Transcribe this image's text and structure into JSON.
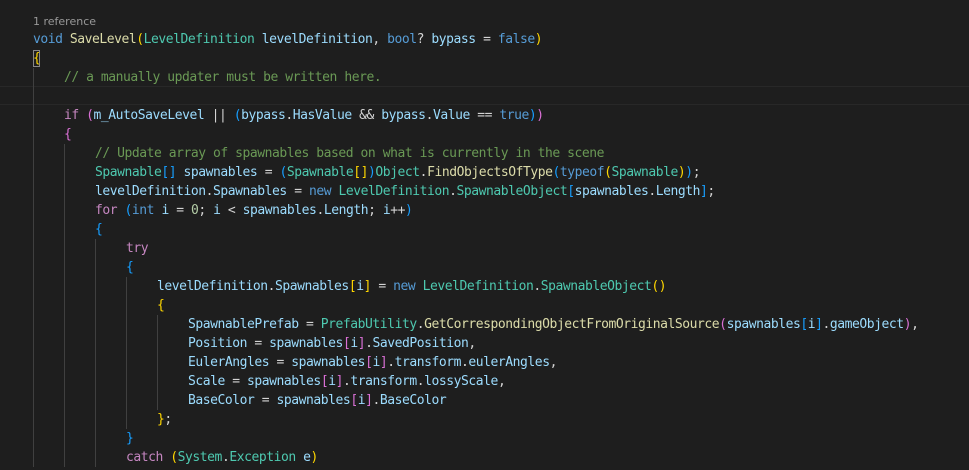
{
  "codelens": {
    "references": "1 reference"
  },
  "theme": {
    "background": "#1e1e1e",
    "keyword": "#569cd6",
    "control": "#c586c0",
    "type": "#4ec9b0",
    "method": "#dcdcaa",
    "variable": "#9cdcfe",
    "comment": "#6a9955",
    "number": "#b5cea8",
    "brace_gold": "#ffd700",
    "brace_purple": "#da70d6",
    "brace_blue": "#179fff",
    "plain": "#d4d4d4"
  },
  "code": [
    {
      "indent": 0,
      "tokens": [
        {
          "t": "void ",
          "c": "keyword"
        },
        {
          "t": "SaveLevel",
          "c": "method"
        },
        {
          "t": "(",
          "c": "brace_gold"
        },
        {
          "t": "LevelDefinition",
          "c": "type"
        },
        {
          "t": " ",
          "c": "plain"
        },
        {
          "t": "levelDefinition",
          "c": "variable"
        },
        {
          "t": ", ",
          "c": "plain"
        },
        {
          "t": "bool",
          "c": "keyword"
        },
        {
          "t": "? ",
          "c": "plain"
        },
        {
          "t": "bypass",
          "c": "variable"
        },
        {
          "t": " = ",
          "c": "plain"
        },
        {
          "t": "false",
          "c": "keyword"
        },
        {
          "t": ")",
          "c": "brace_gold"
        }
      ]
    },
    {
      "indent": 0,
      "tokens": [
        {
          "t": "{",
          "c": "brace_gold"
        }
      ]
    },
    {
      "indent": 1,
      "tokens": [
        {
          "t": "// a manually updater must be written here.",
          "c": "comment"
        }
      ]
    },
    {
      "indent": 0,
      "tokens": []
    },
    {
      "indent": 1,
      "tokens": [
        {
          "t": "if",
          "c": "control"
        },
        {
          "t": " ",
          "c": "plain"
        },
        {
          "t": "(",
          "c": "brace_purple"
        },
        {
          "t": "m_AutoSaveLevel",
          "c": "variable"
        },
        {
          "t": " || ",
          "c": "plain"
        },
        {
          "t": "(",
          "c": "brace_blue"
        },
        {
          "t": "bypass",
          "c": "variable"
        },
        {
          "t": ".",
          "c": "plain"
        },
        {
          "t": "HasValue",
          "c": "variable"
        },
        {
          "t": " && ",
          "c": "plain"
        },
        {
          "t": "bypass",
          "c": "variable"
        },
        {
          "t": ".",
          "c": "plain"
        },
        {
          "t": "Value",
          "c": "variable"
        },
        {
          "t": " == ",
          "c": "plain"
        },
        {
          "t": "true",
          "c": "keyword"
        },
        {
          "t": ")",
          "c": "brace_blue"
        },
        {
          "t": ")",
          "c": "brace_purple"
        }
      ]
    },
    {
      "indent": 1,
      "tokens": [
        {
          "t": "{",
          "c": "brace_purple"
        }
      ]
    },
    {
      "indent": 2,
      "tokens": [
        {
          "t": "// Update array of spawnables based on what is currently in the scene",
          "c": "comment"
        }
      ]
    },
    {
      "indent": 2,
      "tokens": [
        {
          "t": "Spawnable",
          "c": "type"
        },
        {
          "t": "[]",
          "c": "brace_blue"
        },
        {
          "t": " ",
          "c": "plain"
        },
        {
          "t": "spawnables",
          "c": "variable"
        },
        {
          "t": " = ",
          "c": "plain"
        },
        {
          "t": "(",
          "c": "brace_blue"
        },
        {
          "t": "Spawnable",
          "c": "type"
        },
        {
          "t": "[]",
          "c": "brace_gold"
        },
        {
          "t": ")",
          "c": "brace_blue"
        },
        {
          "t": "Object",
          "c": "type"
        },
        {
          "t": ".",
          "c": "plain"
        },
        {
          "t": "FindObjectsOfType",
          "c": "method"
        },
        {
          "t": "(",
          "c": "brace_blue"
        },
        {
          "t": "typeof",
          "c": "keyword"
        },
        {
          "t": "(",
          "c": "brace_gold"
        },
        {
          "t": "Spawnable",
          "c": "type"
        },
        {
          "t": ")",
          "c": "brace_gold"
        },
        {
          "t": ")",
          "c": "brace_blue"
        },
        {
          "t": ";",
          "c": "plain"
        }
      ]
    },
    {
      "indent": 2,
      "tokens": [
        {
          "t": "levelDefinition",
          "c": "variable"
        },
        {
          "t": ".",
          "c": "plain"
        },
        {
          "t": "Spawnables",
          "c": "variable"
        },
        {
          "t": " = ",
          "c": "plain"
        },
        {
          "t": "new",
          "c": "keyword"
        },
        {
          "t": " ",
          "c": "plain"
        },
        {
          "t": "LevelDefinition",
          "c": "type"
        },
        {
          "t": ".",
          "c": "plain"
        },
        {
          "t": "SpawnableObject",
          "c": "type"
        },
        {
          "t": "[",
          "c": "brace_blue"
        },
        {
          "t": "spawnables",
          "c": "variable"
        },
        {
          "t": ".",
          "c": "plain"
        },
        {
          "t": "Length",
          "c": "variable"
        },
        {
          "t": "]",
          "c": "brace_blue"
        },
        {
          "t": ";",
          "c": "plain"
        }
      ]
    },
    {
      "indent": 2,
      "tokens": [
        {
          "t": "for",
          "c": "control"
        },
        {
          "t": " ",
          "c": "plain"
        },
        {
          "t": "(",
          "c": "brace_blue"
        },
        {
          "t": "int",
          "c": "keyword"
        },
        {
          "t": " ",
          "c": "plain"
        },
        {
          "t": "i",
          "c": "variable"
        },
        {
          "t": " = ",
          "c": "plain"
        },
        {
          "t": "0",
          "c": "number"
        },
        {
          "t": "; ",
          "c": "plain"
        },
        {
          "t": "i",
          "c": "variable"
        },
        {
          "t": " < ",
          "c": "plain"
        },
        {
          "t": "spawnables",
          "c": "variable"
        },
        {
          "t": ".",
          "c": "plain"
        },
        {
          "t": "Length",
          "c": "variable"
        },
        {
          "t": "; ",
          "c": "plain"
        },
        {
          "t": "i",
          "c": "variable"
        },
        {
          "t": "++",
          "c": "plain"
        },
        {
          "t": ")",
          "c": "brace_blue"
        }
      ]
    },
    {
      "indent": 2,
      "tokens": [
        {
          "t": "{",
          "c": "brace_blue"
        }
      ]
    },
    {
      "indent": 3,
      "tokens": [
        {
          "t": "try",
          "c": "control"
        }
      ]
    },
    {
      "indent": 3,
      "tokens": [
        {
          "t": "{",
          "c": "brace_blue"
        }
      ]
    },
    {
      "indent": 4,
      "tokens": [
        {
          "t": "levelDefinition",
          "c": "variable"
        },
        {
          "t": ".",
          "c": "plain"
        },
        {
          "t": "Spawnables",
          "c": "variable"
        },
        {
          "t": "[",
          "c": "brace_gold"
        },
        {
          "t": "i",
          "c": "variable"
        },
        {
          "t": "]",
          "c": "brace_gold"
        },
        {
          "t": " = ",
          "c": "plain"
        },
        {
          "t": "new",
          "c": "keyword"
        },
        {
          "t": " ",
          "c": "plain"
        },
        {
          "t": "LevelDefinition",
          "c": "type"
        },
        {
          "t": ".",
          "c": "plain"
        },
        {
          "t": "SpawnableObject",
          "c": "type"
        },
        {
          "t": "()",
          "c": "brace_gold"
        }
      ]
    },
    {
      "indent": 4,
      "tokens": [
        {
          "t": "{",
          "c": "brace_gold"
        }
      ]
    },
    {
      "indent": 5,
      "tokens": [
        {
          "t": "SpawnablePrefab",
          "c": "variable"
        },
        {
          "t": " = ",
          "c": "plain"
        },
        {
          "t": "PrefabUtility",
          "c": "type"
        },
        {
          "t": ".",
          "c": "plain"
        },
        {
          "t": "GetCorrespondingObjectFromOriginalSource",
          "c": "method"
        },
        {
          "t": "(",
          "c": "brace_purple"
        },
        {
          "t": "spawnables",
          "c": "variable"
        },
        {
          "t": "[",
          "c": "brace_blue"
        },
        {
          "t": "i",
          "c": "variable"
        },
        {
          "t": "]",
          "c": "brace_blue"
        },
        {
          "t": ".",
          "c": "plain"
        },
        {
          "t": "gameObject",
          "c": "variable"
        },
        {
          "t": ")",
          "c": "brace_purple"
        },
        {
          "t": ",",
          "c": "plain"
        }
      ]
    },
    {
      "indent": 5,
      "tokens": [
        {
          "t": "Position",
          "c": "variable"
        },
        {
          "t": " = ",
          "c": "plain"
        },
        {
          "t": "spawnables",
          "c": "variable"
        },
        {
          "t": "[",
          "c": "brace_purple"
        },
        {
          "t": "i",
          "c": "variable"
        },
        {
          "t": "]",
          "c": "brace_purple"
        },
        {
          "t": ".",
          "c": "plain"
        },
        {
          "t": "SavedPosition",
          "c": "variable"
        },
        {
          "t": ",",
          "c": "plain"
        }
      ]
    },
    {
      "indent": 5,
      "tokens": [
        {
          "t": "EulerAngles",
          "c": "variable"
        },
        {
          "t": " = ",
          "c": "plain"
        },
        {
          "t": "spawnables",
          "c": "variable"
        },
        {
          "t": "[",
          "c": "brace_purple"
        },
        {
          "t": "i",
          "c": "variable"
        },
        {
          "t": "]",
          "c": "brace_purple"
        },
        {
          "t": ".",
          "c": "plain"
        },
        {
          "t": "transform",
          "c": "variable"
        },
        {
          "t": ".",
          "c": "plain"
        },
        {
          "t": "eulerAngles",
          "c": "variable"
        },
        {
          "t": ",",
          "c": "plain"
        }
      ]
    },
    {
      "indent": 5,
      "tokens": [
        {
          "t": "Scale",
          "c": "variable"
        },
        {
          "t": " = ",
          "c": "plain"
        },
        {
          "t": "spawnables",
          "c": "variable"
        },
        {
          "t": "[",
          "c": "brace_purple"
        },
        {
          "t": "i",
          "c": "variable"
        },
        {
          "t": "]",
          "c": "brace_purple"
        },
        {
          "t": ".",
          "c": "plain"
        },
        {
          "t": "transform",
          "c": "variable"
        },
        {
          "t": ".",
          "c": "plain"
        },
        {
          "t": "lossyScale",
          "c": "variable"
        },
        {
          "t": ",",
          "c": "plain"
        }
      ]
    },
    {
      "indent": 5,
      "tokens": [
        {
          "t": "BaseColor",
          "c": "variable"
        },
        {
          "t": " = ",
          "c": "plain"
        },
        {
          "t": "spawnables",
          "c": "variable"
        },
        {
          "t": "[",
          "c": "brace_purple"
        },
        {
          "t": "i",
          "c": "variable"
        },
        {
          "t": "]",
          "c": "brace_purple"
        },
        {
          "t": ".",
          "c": "plain"
        },
        {
          "t": "BaseColor",
          "c": "variable"
        }
      ]
    },
    {
      "indent": 4,
      "tokens": [
        {
          "t": "}",
          "c": "brace_gold"
        },
        {
          "t": ";",
          "c": "plain"
        }
      ]
    },
    {
      "indent": 3,
      "tokens": [
        {
          "t": "}",
          "c": "brace_blue"
        }
      ]
    },
    {
      "indent": 3,
      "tokens": [
        {
          "t": "catch",
          "c": "control"
        },
        {
          "t": " ",
          "c": "plain"
        },
        {
          "t": "(",
          "c": "brace_gold"
        },
        {
          "t": "System",
          "c": "type"
        },
        {
          "t": ".",
          "c": "plain"
        },
        {
          "t": "Exception",
          "c": "type"
        },
        {
          "t": " ",
          "c": "plain"
        },
        {
          "t": "e",
          "c": "variable"
        },
        {
          "t": ")",
          "c": "brace_gold"
        }
      ]
    }
  ]
}
